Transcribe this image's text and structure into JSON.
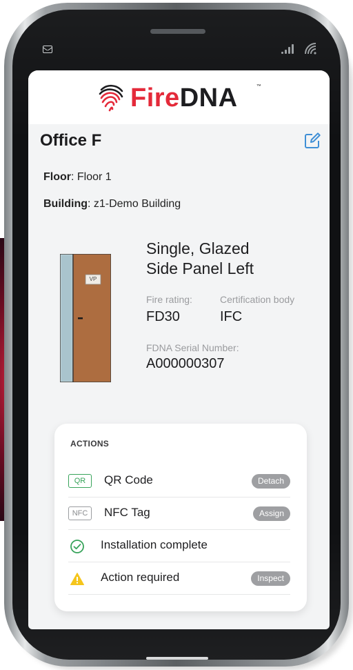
{
  "app": {
    "logo_fire": "Fire",
    "logo_dna": "DNA",
    "logo_tm": "™"
  },
  "door": {
    "title": "Office F",
    "floor_label": "Floor",
    "floor_value": "Floor 1",
    "building_label": "Building",
    "building_value": "z1-Demo Building",
    "type_line1": "Single, Glazed",
    "type_line2": "Side Panel Left",
    "vp_label": "VP",
    "fire_rating_label": "Fire rating:",
    "fire_rating_value": "FD30",
    "cert_body_label": "Certification body",
    "cert_body_value": "IFC",
    "serial_label": "FDNA Serial Number:",
    "serial_value": "A000000307"
  },
  "actions": {
    "heading": "ACTIONS",
    "items": [
      {
        "badge": "QR",
        "label": "QR Code",
        "button": "Detach"
      },
      {
        "badge": "NFC",
        "label": "NFC Tag",
        "button": "Assign"
      },
      {
        "icon": "check-circle-icon",
        "label": "Installation complete"
      },
      {
        "icon": "warning-icon",
        "label": "Action required",
        "button": "Inspect"
      }
    ]
  },
  "colors": {
    "brand_red": "#e42a3a",
    "accent_blue": "#3f8fd6",
    "success_green": "#37a35a",
    "warning_yellow": "#f5c51b",
    "pill_grey": "#9e9fa2"
  }
}
